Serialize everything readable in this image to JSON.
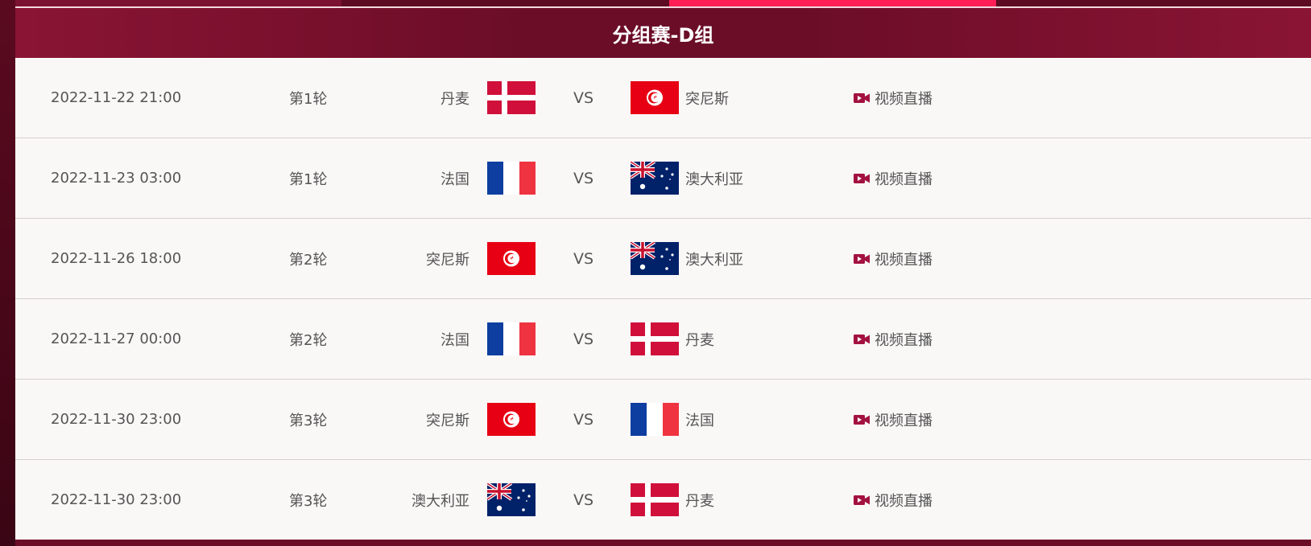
{
  "header": {
    "title": "分组赛-D组"
  },
  "live_label": "视频直播",
  "vs_label": "VS",
  "matches": [
    {
      "time": "2022-11-22 21:00",
      "round": "第1轮",
      "home": "丹麦",
      "home_flag": "denmark",
      "away": "突尼斯",
      "away_flag": "tunisia"
    },
    {
      "time": "2022-11-23 03:00",
      "round": "第1轮",
      "home": "法国",
      "home_flag": "france",
      "away": "澳大利亚",
      "away_flag": "australia"
    },
    {
      "time": "2022-11-26 18:00",
      "round": "第2轮",
      "home": "突尼斯",
      "home_flag": "tunisia",
      "away": "澳大利亚",
      "away_flag": "australia"
    },
    {
      "time": "2022-11-27 00:00",
      "round": "第2轮",
      "home": "法国",
      "home_flag": "france",
      "away": "丹麦",
      "away_flag": "denmark"
    },
    {
      "time": "2022-11-30 23:00",
      "round": "第3轮",
      "home": "突尼斯",
      "home_flag": "tunisia",
      "away": "法国",
      "away_flag": "france"
    },
    {
      "time": "2022-11-30 23:00",
      "round": "第3轮",
      "home": "澳大利亚",
      "home_flag": "australia",
      "away": "丹麦",
      "away_flag": "denmark"
    }
  ],
  "colors": {
    "header_bg": "#6b0d27",
    "accent": "#ff1f56",
    "text": "#555555",
    "icon": "#a3123f"
  }
}
